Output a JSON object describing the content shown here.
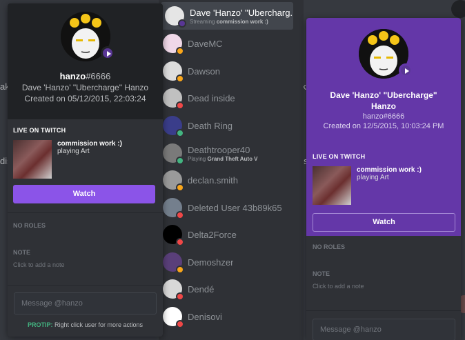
{
  "background": {
    "fragments": [
      "ak",
      "dis",
      "ak",
      "dis"
    ]
  },
  "left_popout": {
    "username": "hanzo",
    "discriminator": "#6666",
    "display_name": "Dave 'Hanzo' \"Ubercharge\" Hanzo",
    "created": "Created on 05/12/2015, 22:03:24",
    "live_header": "LIVE ON TWITCH",
    "stream_title": "commission work :)",
    "stream_game": "playing Art",
    "watch_label": "Watch",
    "roles_label": "NO ROLES",
    "note_label": "NOTE",
    "note_placeholder": "Click to add a note",
    "message_placeholder": "Message @hanzo",
    "protip_label": "PROTIP:",
    "protip_text": "Right click user for more actions"
  },
  "right_popout": {
    "display_name": "Dave 'Hanzo' \"Ubercharge\" Hanzo",
    "tag": "hanzo#6666",
    "created": "Created on 12/5/2015, 10:03:24 PM",
    "live_header": "LIVE ON TWITCH",
    "stream_title": "commission work :)",
    "stream_game": "playing Art",
    "watch_label": "Watch",
    "roles_label": "NO ROLES",
    "note_label": "NOTE",
    "note_placeholder": "Click to add a note",
    "message_placeholder": "Message @hanzo"
  },
  "members": [
    {
      "name": "Dave 'Hanzo' \"Ubercharg...",
      "activity_prefix": "Streaming",
      "activity_bold": "commission work :)",
      "status_color": "#593695",
      "avatar_color": "#e5e5e5",
      "selected": true
    },
    {
      "name": "DaveMC",
      "status_color": "#faa61a",
      "avatar_color": "#f0d8e8"
    },
    {
      "name": "Dawson",
      "status_color": "#faa61a",
      "avatar_color": "#dddddd"
    },
    {
      "name": "Dead inside",
      "status_color": "#f04747",
      "avatar_color": "#c0c0c0"
    },
    {
      "name": "Death Ring",
      "status_color": "#43b581",
      "avatar_color": "#3a3d8a"
    },
    {
      "name": "Deathtrooper40",
      "activity_prefix": "Playing",
      "activity_bold": "Grand Theft Auto V",
      "status_color": "#43b581",
      "avatar_color": "#7a7a7a"
    },
    {
      "name": "declan.smith",
      "status_color": "#faa61a",
      "avatar_color": "#9a9a9a"
    },
    {
      "name": "Deleted User 43b89k65",
      "status_color": "#f04747",
      "avatar_color": "#747f8d"
    },
    {
      "name": "Delta2Force",
      "status_color": "#f04747",
      "avatar_color": "#000000"
    },
    {
      "name": "Demoshzer",
      "status_color": "#faa61a",
      "avatar_color": "#5a3f7a"
    },
    {
      "name": "Dendé",
      "status_color": "#f04747",
      "avatar_color": "#d8d8d8"
    },
    {
      "name": "Denisovi",
      "status_color": "#f04747",
      "avatar_color": "#ffffff"
    }
  ],
  "colors": {
    "twitch_purple": "#593695",
    "accent": "#8b54e8",
    "online": "#43b581",
    "idle": "#faa61a",
    "dnd": "#f04747"
  }
}
